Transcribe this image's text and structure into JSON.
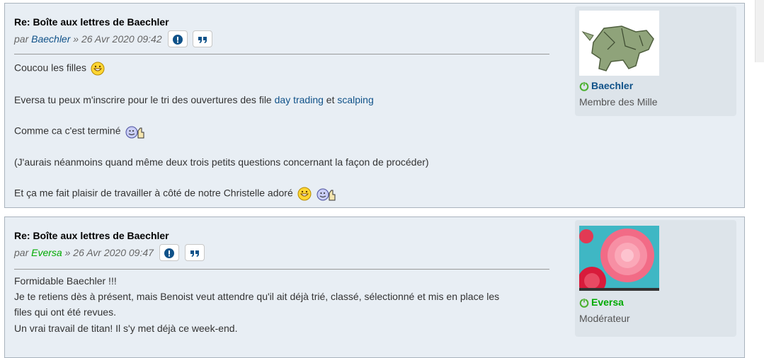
{
  "posts": [
    {
      "title": "Re: Boîte aux lettres de Baechler",
      "by": "par",
      "author": "Baechler",
      "author_color": "#105289",
      "sep": "»",
      "date": "26 Avr 2020 09:42",
      "lines": {
        "l1": "Coucou les filles",
        "l2_a": "Eversa tu peux m'inscrire pour le tri des ouvertures des file",
        "l2_link1": "day trading",
        "l2_b": "et",
        "l2_link2": "scalping",
        "l3": "Comme ca c'est terminé",
        "l4": "(J'aurais néanmoins quand même deux trois petits questions concernant la façon de procéder)",
        "l5": "Et ça me fait plaisir de travailler à côté de notre Christelle adoré"
      },
      "profile": {
        "name": "Baechler",
        "name_color": "#105289",
        "rank": "Membre des Mille",
        "avatar": "folded-dollar-origami"
      }
    },
    {
      "title": "Re: Boîte aux lettres de Baechler",
      "by": "par",
      "author": "Eversa",
      "author_color": "#00AA00",
      "sep": "»",
      "date": "26 Avr 2020 09:47",
      "lines": {
        "l1": "Formidable Baechler !!!",
        "l2": "Je te retiens dès à présent, mais Benoist veut attendre qu'il ait déjà trié, classé, sélectionné et mis en place les",
        "l3": "files qui ont été revues.",
        "l4": "Un vrai travail de titan! Il s'y met déjà ce week-end."
      },
      "profile": {
        "name": "Eversa",
        "name_color": "#00AA00",
        "rank": "Modérateur",
        "avatar": "pink-roses"
      }
    }
  ],
  "icons": {
    "report": "report-icon",
    "quote": "quote-icon",
    "online": "online-power-icon",
    "grin": "grin-emoji",
    "thumbs_up": "thumbs-up-emoji"
  }
}
